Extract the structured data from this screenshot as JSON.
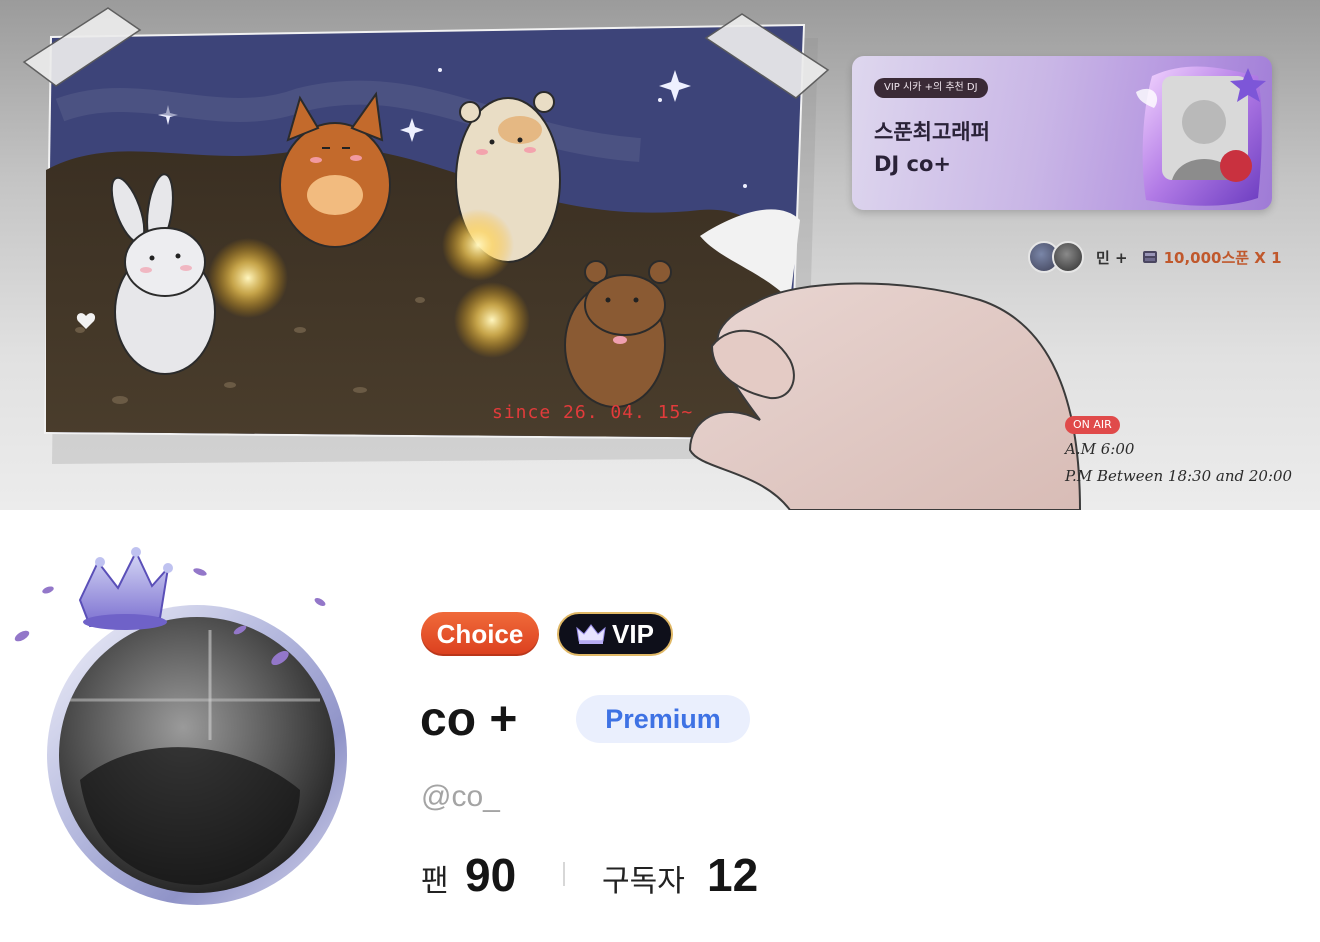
{
  "banner": {
    "stamp": "since 26. 04. 15~",
    "recommend": {
      "badge": "VIP 시카 +의 추천 DJ",
      "title_line1": "스푼최고래퍼",
      "title_line2": "DJ co+"
    },
    "gift": {
      "sender": "민 +",
      "amount": "10,000스푼 X 1"
    },
    "on_air": {
      "badge": "ON AIR",
      "line1": "A.M 6:00",
      "line2": "P.M Between 18:30 and 20:00"
    }
  },
  "profile": {
    "badges": {
      "choice": "Choice",
      "vip": "VIP"
    },
    "nickname": "co +",
    "tier": "Premium",
    "handle": "@co_",
    "stats": {
      "fan_label": "팬",
      "fan_value": "90",
      "subscriber_label": "구독자",
      "subscriber_value": "12"
    }
  },
  "colors": {
    "choice": "#e8532b",
    "vip_border": "#e0b866",
    "premium_text": "#3e72e4",
    "premium_bg": "#eaeffd",
    "gift_text": "#c0582c",
    "on_air": "#e04a4a"
  },
  "icons": [
    "crown-icon",
    "lavender-icon",
    "gift-spoon-icon"
  ]
}
